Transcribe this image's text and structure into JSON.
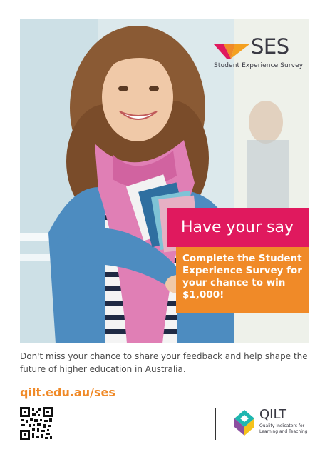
{
  "brand": {
    "logo_text": "SES",
    "logo_subtitle": "Student Experience Survey"
  },
  "headline": {
    "primary": "Have your say",
    "secondary": "Complete the Student Experience Survey for your chance to win $1,000!"
  },
  "body": {
    "description": "Don't miss your chance to share your feedback and help shape the future of higher education in Australia.",
    "url": "qilt.edu.au/ses"
  },
  "partner": {
    "logo_text": "QILT",
    "logo_subtitle": "Quality Indicators for Learning and Teaching"
  },
  "colors": {
    "pink": "#e0195e",
    "orange": "#f08a28",
    "qilt_teal": "#1fb7b0",
    "qilt_purple": "#8b4fa0",
    "qilt_yellow": "#f5c21b"
  },
  "icons": [
    "qr-code-icon",
    "ses-logo-mark",
    "qilt-logo-mark"
  ]
}
